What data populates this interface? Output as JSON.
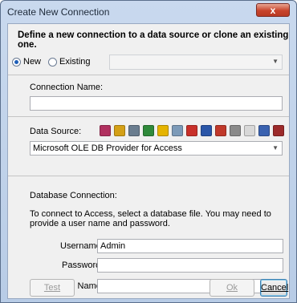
{
  "window": {
    "title": "Create New Connection",
    "close_glyph": "x"
  },
  "define": {
    "heading": "Define a new connection to a data source or clone an existing one.",
    "new_label": "New",
    "existing_label": "Existing",
    "existing_value": ""
  },
  "connection_name": {
    "label": "Connection Name:",
    "value": ""
  },
  "data_source": {
    "label": "Data Source:",
    "selected": "Microsoft OLE DB Provider for Access",
    "icons": [
      {
        "name": "access-icon",
        "color": "#b0305f"
      },
      {
        "name": "xls-icon",
        "color": "#d4a017"
      },
      {
        "name": "db-icon",
        "color": "#6a7d8f"
      },
      {
        "name": "excel-icon",
        "color": "#2f8a3b"
      },
      {
        "name": "olap-icon",
        "color": "#e5b400"
      },
      {
        "name": "odbc-icon",
        "color": "#7c9ab8"
      },
      {
        "name": "oracle-icon",
        "color": "#c8302a"
      },
      {
        "name": "db2-icon",
        "color": "#2a56a8"
      },
      {
        "name": "sybase-icon",
        "color": "#c0392b"
      },
      {
        "name": "sql-icon",
        "color": "#8a8a8a"
      },
      {
        "name": "text-file-icon",
        "color": "#d8d8d8"
      },
      {
        "name": "xml-icon",
        "color": "#3a62b0"
      },
      {
        "name": "web-icon",
        "color": "#9c2a2a"
      }
    ]
  },
  "db_connection": {
    "label": "Database Connection:",
    "instructions": "To connect to Access, select a database file. You may need to provide a user name and password.",
    "username_label": "Username:",
    "username_value": "Admin",
    "password_label": "Password:",
    "password_value": "",
    "file_label": "Full File Name:",
    "file_value": "",
    "browse_label": "..."
  },
  "buttons": {
    "test_label": "Test",
    "ok_label": "Ok",
    "cancel_label": "Cancel"
  }
}
